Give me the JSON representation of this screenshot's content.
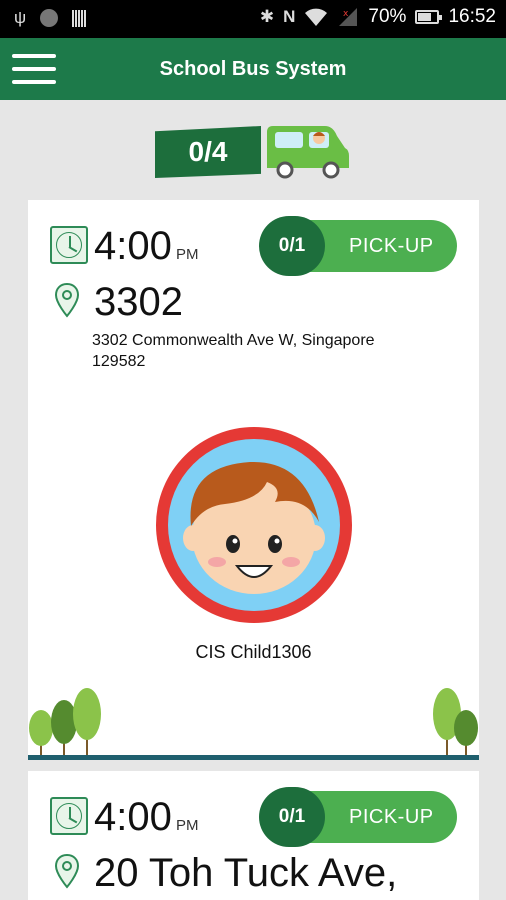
{
  "status_bar": {
    "battery_percent": "70%",
    "time": "16:52",
    "battery_level": 0.7,
    "icons": [
      "usb-icon",
      "sim-icon",
      "barcode-icon",
      "bluetooth-icon",
      "nfc-icon",
      "wifi-icon",
      "signal-icon",
      "battery-icon"
    ]
  },
  "app_bar": {
    "title": "School Bus System",
    "menu_icon": "hamburger-menu-icon",
    "color": "#1d7a4a"
  },
  "progress": {
    "label": "0/4",
    "icon": "school-bus-icon"
  },
  "cards": [
    {
      "time": "4:00",
      "time_suffix": "PM",
      "place": "3302",
      "address_line1": "3302 Commonwealth Ave W, Singapore",
      "address_line2": "129582",
      "pickup_count": "0/1",
      "pickup_label": "PICK-UP",
      "child_name": "CIS Child1306"
    },
    {
      "time": "4:00",
      "time_suffix": "PM",
      "place": "20 Toh Tuck Ave,",
      "pickup_count": "0/1",
      "pickup_label": "PICK-UP"
    }
  ],
  "colors": {
    "primary": "#1d7a4a",
    "dark_green": "#1d6e3c",
    "pill_green": "#4caf50",
    "avatar_ring": "#e53935",
    "avatar_bg": "#7fd0f5",
    "background": "#e6e6e6"
  }
}
